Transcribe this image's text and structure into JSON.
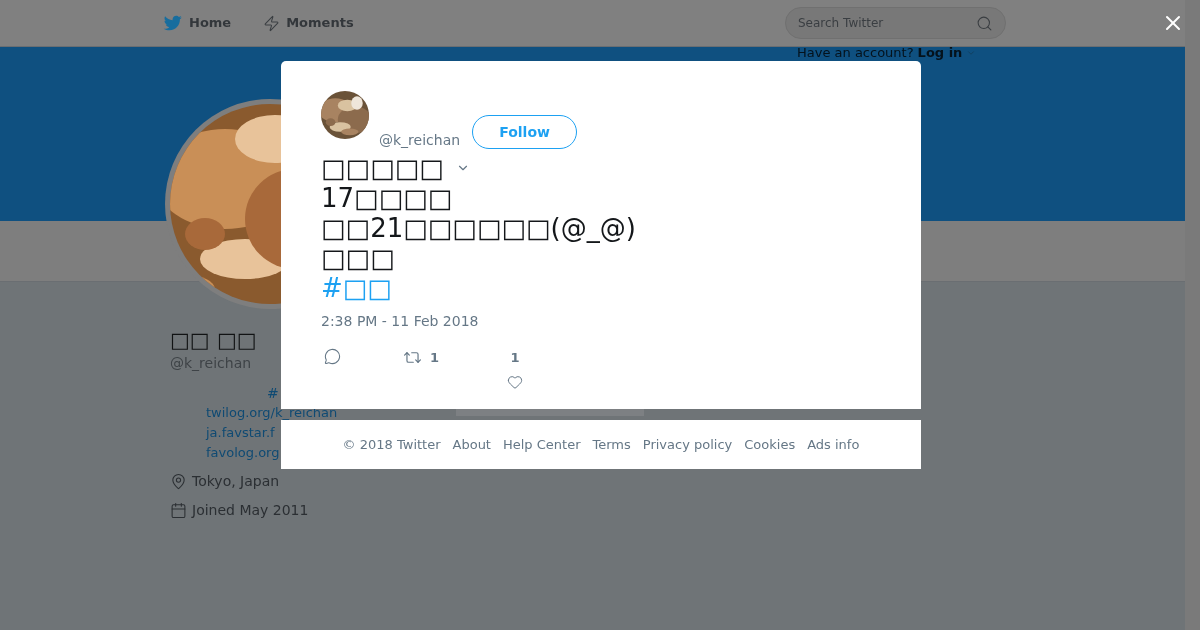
{
  "nav": {
    "items": [
      {
        "label": "Home"
      },
      {
        "label": "Moments"
      }
    ]
  },
  "search": {
    "placeholder": "Search Twitter"
  },
  "login_prompt": {
    "text": "Have an account?",
    "link": "Log in"
  },
  "profile": {
    "name": "□□ □□",
    "handle": "@k_reichan",
    "bio_fragment": "#",
    "links": [
      "twilog.org/k_reichan",
      "ja.favstar.f",
      "favolog.org"
    ],
    "location": "Tokyo, Japan",
    "joined": "Joined May 2011"
  },
  "tweet": {
    "handle": "@k_reichan",
    "follow_button": "Follow",
    "lines": [
      "□□□□□",
      "17□□□□",
      "□□21□□□□□□(@_@)",
      "□□□"
    ],
    "hashtag": "#□□",
    "timestamp": "2:38 PM - 11 Feb 2018",
    "retweets": "1",
    "likes": "1"
  },
  "footer": {
    "copyright": "© 2018 Twitter",
    "links": [
      "About",
      "Help Center",
      "Terms",
      "Privacy policy",
      "Cookies",
      "Ads info"
    ]
  }
}
